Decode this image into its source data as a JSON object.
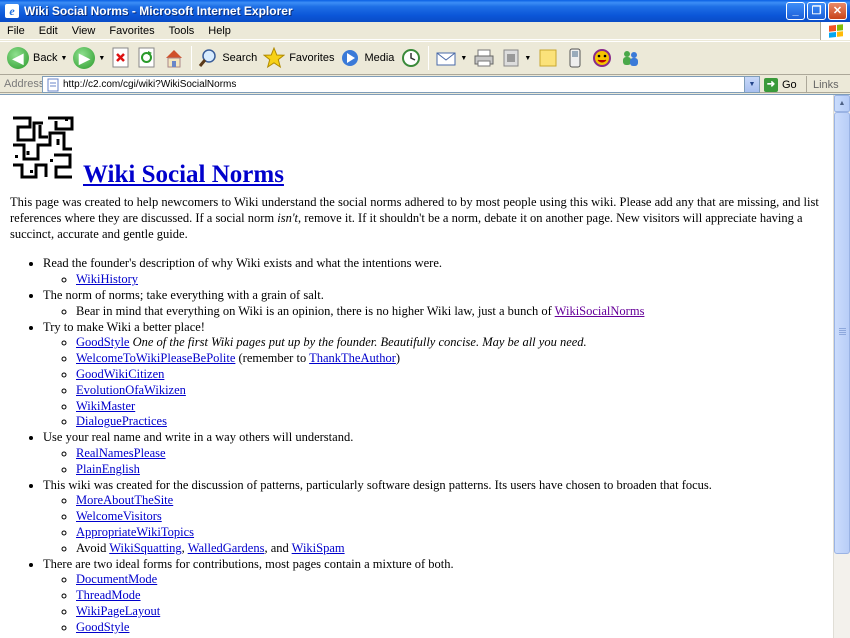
{
  "window": {
    "title": "Wiki Social Norms - Microsoft Internet Explorer",
    "app_icon_letter": "e"
  },
  "window_buttons": {
    "minimize": "_",
    "maximize": "❐",
    "close": "✕"
  },
  "menu": [
    "File",
    "Edit",
    "View",
    "Favorites",
    "Tools",
    "Help"
  ],
  "toolbar": {
    "back": "Back",
    "search": "Search",
    "favorites": "Favorites",
    "media": "Media"
  },
  "address": {
    "label": "Address",
    "url": "http://c2.com/cgi/wiki?WikiSocialNorms",
    "go": "Go",
    "links": "Links"
  },
  "page": {
    "title": "Wiki Social Norms",
    "intro_1": "This page was created to help newcomers to Wiki understand the social norms adhered to by most people using this wiki. Please add any that are missing, and list references where they are discussed. If a social norm ",
    "intro_em": "isn't",
    "intro_2": ", remove it. If it shouldn't be a norm, debate it on another page. New visitors will appreciate having a succinct, accurate and gentle guide.",
    "sections": [
      {
        "text": "Read the founder's description of why Wiki exists and what the intentions were.",
        "link1": "WikiHistory"
      },
      {
        "text": "The norm of norms; take everything with a grain of salt.",
        "sub_text": "Bear in mind that everything on Wiki is an opinion, there is no higher Wiki law, just a bunch of ",
        "sub_link": "WikiSocialNorms"
      },
      {
        "text": "Try to make Wiki a better place!",
        "goodstyle": "GoodStyle",
        "goodstyle_note": " One of the first Wiki pages put up by the founder. Beautifully concise. May be all you need.",
        "welcome": "WelcomeToWikiPleaseBePolite",
        "welcome_note_1": " (remember to ",
        "thank": "ThankTheAuthor",
        "welcome_note_2": ")",
        "citizen": "GoodWikiCitizen",
        "evolution": "EvolutionOfaWikizen",
        "master": "WikiMaster",
        "dialogue": "DialoguePractices"
      },
      {
        "text": "Use your real name and write in a way others will understand.",
        "realnames": "RealNamesPlease",
        "plain": "PlainEnglish"
      },
      {
        "text": "This wiki was created for the discussion of patterns, particularly software design patterns. Its users have chosen to broaden that focus.",
        "more": "MoreAboutTheSite",
        "visitors": "WelcomeVisitors",
        "topics": "AppropriateWikiTopics",
        "avoid": "Avoid ",
        "squatting": "WikiSquatting",
        "comma": ", ",
        "walled": "WalledGardens",
        "and": ", and ",
        "spam": "WikiSpam"
      },
      {
        "text": "There are two ideal forms for contributions, most pages contain a mixture of both.",
        "docmode": "DocumentMode",
        "threadmode": "ThreadMode",
        "layout": "WikiPageLayout",
        "goodstyle2": "GoodStyle"
      }
    ]
  }
}
